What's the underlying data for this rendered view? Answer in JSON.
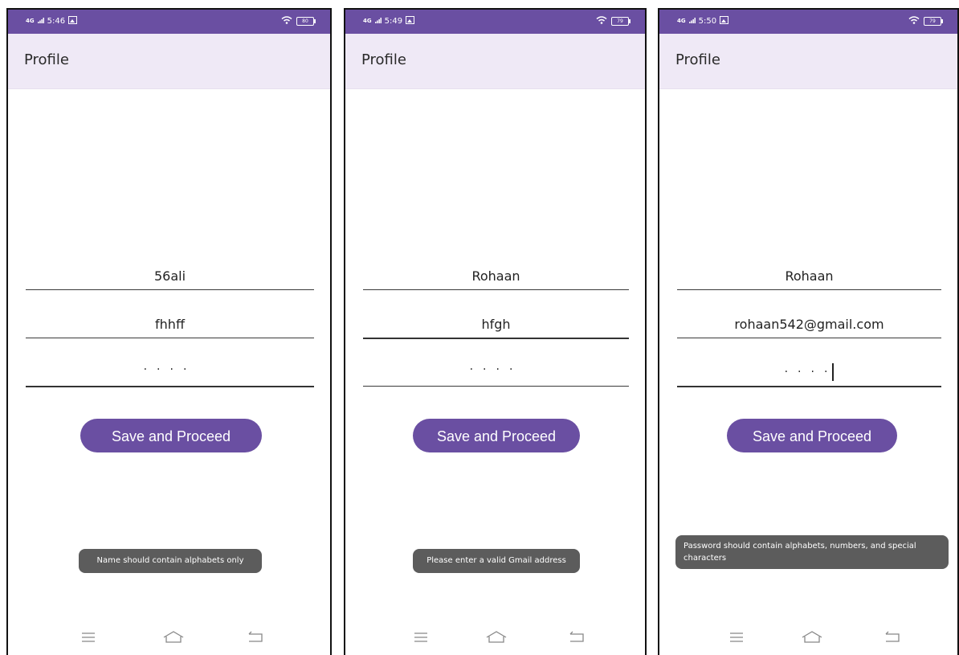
{
  "colors": {
    "accent": "#6a4fa2",
    "appbar_bg": "#efe9f6",
    "toast_bg": "#5c5c5c"
  },
  "screens": [
    {
      "status": {
        "network": "4G",
        "time": "5:46",
        "battery": "80"
      },
      "title": "Profile",
      "name_value": "56ali",
      "email_value": "fhhff",
      "password_value": "····",
      "button_label": "Save and Proceed",
      "toast": "Name should contain alphabets only"
    },
    {
      "status": {
        "network": "4G",
        "time": "5:49",
        "battery": "79"
      },
      "title": "Profile",
      "name_value": "Rohaan",
      "email_value": "hfgh",
      "password_value": "····",
      "button_label": "Save and Proceed",
      "toast": "Please enter a valid Gmail address"
    },
    {
      "status": {
        "network": "4G",
        "time": "5:50",
        "battery": "79"
      },
      "title": "Profile",
      "name_value": "Rohaan",
      "email_value": "rohaan542@gmail.com",
      "password_value": "····",
      "button_label": "Save and Proceed",
      "toast": "Password should contain alphabets, numbers, and special characters"
    }
  ],
  "icons": {
    "status_left": "gallery-icon",
    "status_right": [
      "wifi-icon",
      "battery-icon"
    ],
    "nav": [
      "menu-icon",
      "home-icon",
      "back-icon"
    ]
  }
}
